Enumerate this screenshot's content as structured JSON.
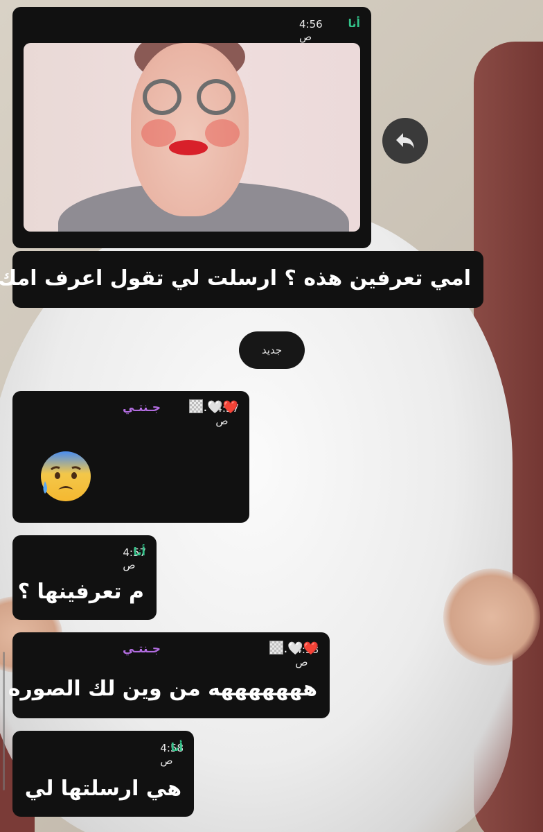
{
  "divider": {
    "new_label": "جديد"
  },
  "messages": [
    {
      "sender": "أنا",
      "time": "4:56 ص",
      "text": "امي تعرفين هذه ؟ ارسلت لي تقول اعرف امك"
    },
    {
      "sender": "جـنتـي",
      "time": "4:57 ص",
      "text": "😰"
    },
    {
      "sender": "أنا",
      "time": "4:57 ص",
      "text": "م تعرفينها ؟"
    },
    {
      "sender": "جـنتـي",
      "time": "4:58 ص",
      "text": "هههههههه من وين لك الصوره"
    },
    {
      "sender": "أنا",
      "time": "4:58 ص",
      "text": "هي ارسلتها لي"
    }
  ],
  "name_decoration": ".🤍❤️",
  "icons": {
    "reply": "reply-arrow-icon",
    "face_emoji": "anxious-face-with-sweat-icon"
  }
}
